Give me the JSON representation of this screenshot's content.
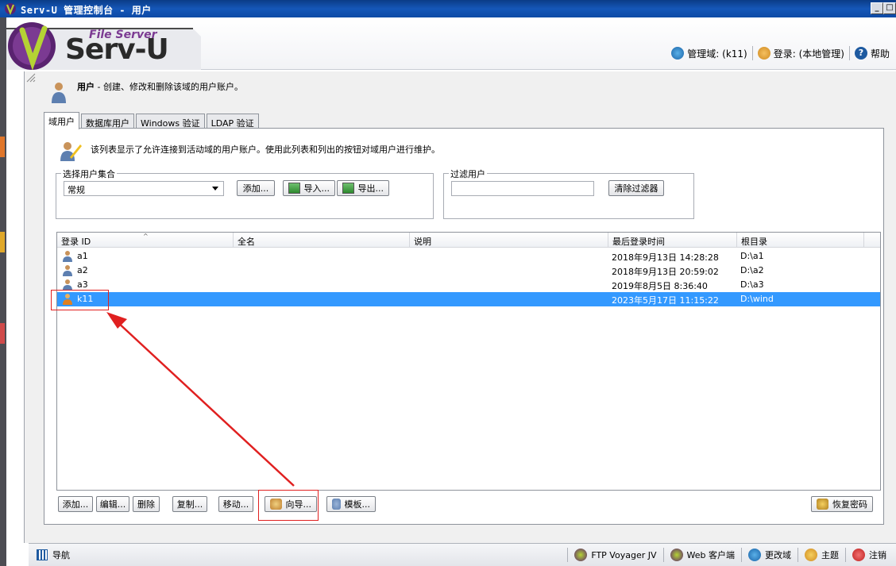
{
  "window": {
    "title": "Serv-U 管理控制台 - 用户",
    "minimize": "_",
    "maximize": "□"
  },
  "header": {
    "logo_small": "File Server",
    "logo_big": "Serv-U",
    "domain_label": "管理域: (k11)",
    "login_label": "登录: (本地管理)",
    "help_label": "帮助"
  },
  "page": {
    "title_bold": "用户",
    "title_rest": " - 创建、修改和删除该域的用户账户。"
  },
  "tabs": [
    {
      "label": "域用户",
      "active": true
    },
    {
      "label": "数据库用户",
      "active": false
    },
    {
      "label": "Windows 验证",
      "active": false
    },
    {
      "label": "LDAP 验证",
      "active": false
    }
  ],
  "panel": {
    "description": "该列表显示了允许连接到活动域的用户账户。使用此列表和列出的按钮对域用户进行维护。",
    "user_set": {
      "group_label": "选择用户集合",
      "selected": "常规",
      "add_button": "添加...",
      "import_button": "导入...",
      "export_button": "导出..."
    },
    "filter": {
      "group_label": "过滤用户",
      "value": "",
      "clear_button": "清除过滤器"
    }
  },
  "table": {
    "columns": [
      "登录 ID",
      "全名",
      "说明",
      "最后登录时间",
      "根目录"
    ],
    "rows": [
      {
        "login_id": "a1",
        "full_name": "",
        "description": "",
        "last_login": "2018年9月13日 14:28:28",
        "root_dir": "D:\\a1",
        "selected": false
      },
      {
        "login_id": "a2",
        "full_name": "",
        "description": "",
        "last_login": "2018年9月13日 20:59:02",
        "root_dir": "D:\\a2",
        "selected": false
      },
      {
        "login_id": "a3",
        "full_name": "",
        "description": "",
        "last_login": "2019年8月5日 8:36:40",
        "root_dir": "D:\\a3",
        "selected": false
      },
      {
        "login_id": "k11",
        "full_name": "",
        "description": "",
        "last_login": "2023年5月17日 11:15:22",
        "root_dir": "D:\\wind",
        "selected": true
      }
    ]
  },
  "actions": {
    "add": "添加...",
    "edit": "编辑...",
    "delete": "删除",
    "copy": "复制...",
    "move": "移动...",
    "wizard": "向导...",
    "template": "模板...",
    "recover_password": "恢复密码"
  },
  "statusbar": {
    "nav": "导航",
    "ftp_voyager": "FTP Voyager JV",
    "web_client": "Web 客户端",
    "change_domain": "更改域",
    "theme": "主题",
    "logout": "注销"
  },
  "colors": {
    "titlebar": "#1557b8",
    "selection": "#3399ff",
    "callout": "#e02020",
    "logo_purple": "#6b2a7e"
  }
}
